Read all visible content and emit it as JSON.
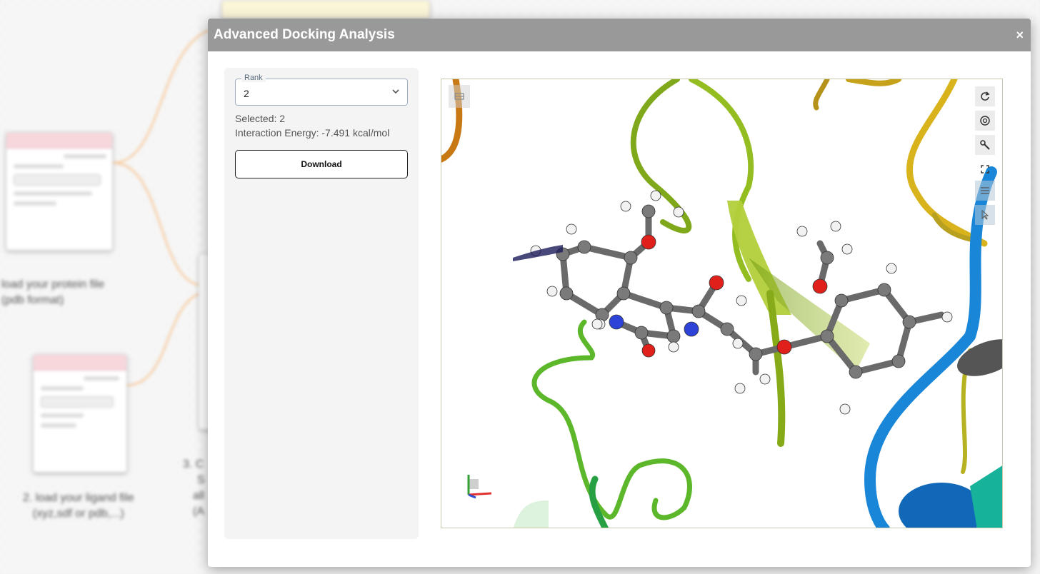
{
  "background": {
    "caption_protein": [
      "load your protein file",
      "(pdb format)"
    ],
    "caption_ligand": [
      "2. load your ligand file",
      "(xyz,sdf or pdb,...)"
    ],
    "caption_third": [
      "3. C",
      "S",
      "all",
      "(A"
    ]
  },
  "modal": {
    "title": "Advanced Docking Analysis",
    "close_label": "×"
  },
  "sidebar": {
    "rank_label": "Rank",
    "rank_value": "2",
    "selected_text": "Selected: 2",
    "energy_text": "Interaction Energy: -7.491 kcal/mol",
    "download_label": "Download"
  },
  "viewer": {
    "toolbar_icons": [
      "rotate-icon",
      "aperture-icon",
      "wrench-icon",
      "fullscreen-icon",
      "sliders-icon",
      "cursor-icon"
    ],
    "colors": {
      "carbon": "#7a7a7a",
      "oxygen": "#e0201a",
      "nitrogen": "#2d43d8",
      "hydrogen": "#f2f2f2",
      "ribbon_green": "#8fbf1f",
      "ribbon_blue": "#1a86d8",
      "ribbon_yellow": "#d8b01a"
    }
  }
}
